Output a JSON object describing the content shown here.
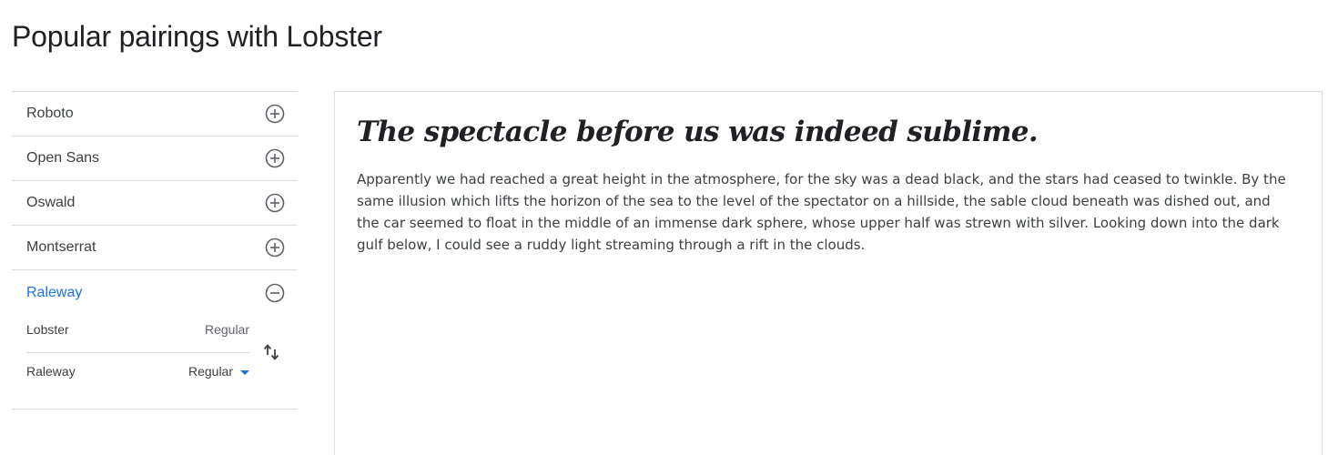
{
  "page": {
    "title": "Popular pairings with Lobster"
  },
  "sidebar": {
    "fonts": [
      {
        "label": "Roboto",
        "icon": "add-circle-icon"
      },
      {
        "label": "Open Sans",
        "icon": "add-circle-icon"
      },
      {
        "label": "Oswald",
        "icon": "add-circle-icon"
      },
      {
        "label": "Montserrat",
        "icon": "add-circle-icon"
      },
      {
        "label": "Raleway",
        "icon": "remove-circle-icon",
        "active": true
      }
    ],
    "pairing": {
      "heading_font": "Lobster",
      "heading_style": "Regular",
      "body_font": "Raleway",
      "body_style": "Regular"
    }
  },
  "preview": {
    "heading": "The spectacle before us was indeed sublime.",
    "body": "Apparently we had reached a great height in the atmosphere, for the sky was a dead black, and the stars had ceased to twinkle. By the same illusion which lifts the horizon of the sea to the level of the spectator on a hillside, the sable cloud beneath was dished out, and the car seemed to float in the middle of an immense dark sphere, whose upper half was strewn with silver. Looking down into the dark gulf below, I could see a ruddy light streaming through a rift in the clouds."
  },
  "colors": {
    "accent": "#1a73e8",
    "text": "#3c4043",
    "divider": "#dadce0"
  }
}
